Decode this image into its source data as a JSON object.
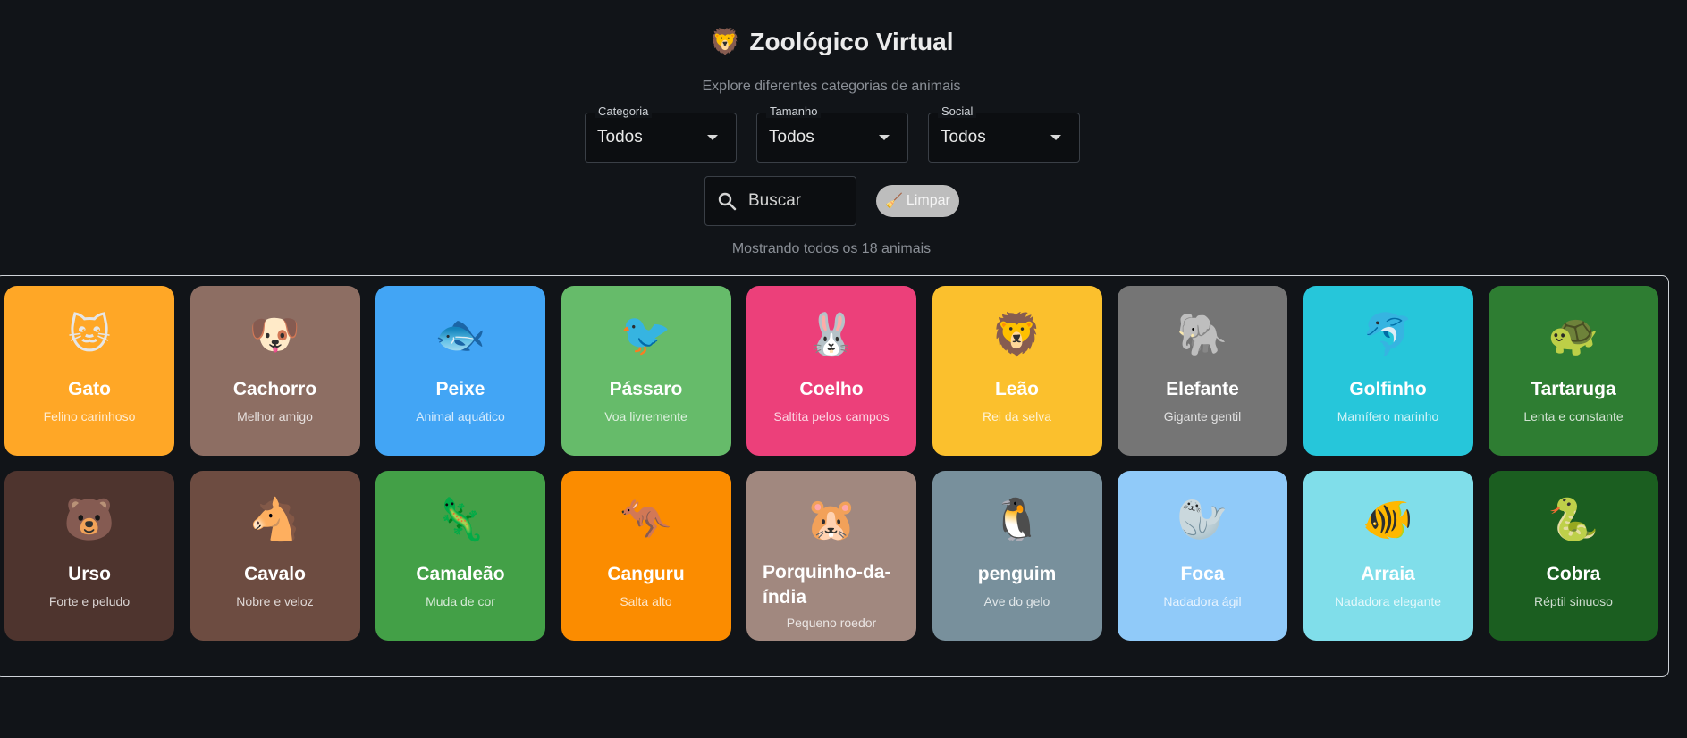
{
  "header": {
    "logo_emoji": "🦁",
    "title": "Zoológico Virtual",
    "subtitle": "Explore diferentes categorias de animais"
  },
  "filters": [
    {
      "label": "Categoria",
      "value": "Todos"
    },
    {
      "label": "Tamanho",
      "value": "Todos"
    },
    {
      "label": "Social",
      "value": "Todos"
    }
  ],
  "search": {
    "placeholder": "Buscar",
    "value": ""
  },
  "clear_button": {
    "emoji": "🧹",
    "label": "Limpar"
  },
  "status_text": "Mostrando todos os 18 animais",
  "animals": [
    {
      "emoji": "🐱",
      "name": "Gato",
      "desc": "Felino carinhoso",
      "color": "#FFA726"
    },
    {
      "emoji": "🐶",
      "name": "Cachorro",
      "desc": "Melhor amigo",
      "color": "#8D6E63"
    },
    {
      "emoji": "🐟",
      "name": "Peixe",
      "desc": "Animal aquático",
      "color": "#42A5F5"
    },
    {
      "emoji": "🐦",
      "name": "Pássaro",
      "desc": "Voa livremente",
      "color": "#66BB6A"
    },
    {
      "emoji": "🐰",
      "name": "Coelho",
      "desc": "Saltita pelos campos",
      "color": "#EC407A"
    },
    {
      "emoji": "🦁",
      "name": "Leão",
      "desc": "Rei da selva",
      "color": "#FBC02D"
    },
    {
      "emoji": "🐘",
      "name": "Elefante",
      "desc": "Gigante gentil",
      "color": "#757575"
    },
    {
      "emoji": "🐬",
      "name": "Golfinho",
      "desc": "Mamífero marinho",
      "color": "#26C6DA"
    },
    {
      "emoji": "🐢",
      "name": "Tartaruga",
      "desc": "Lenta e constante",
      "color": "#2E7D32"
    },
    {
      "emoji": "🐻",
      "name": "Urso",
      "desc": "Forte e peludo",
      "color": "#4E342E"
    },
    {
      "emoji": "🐴",
      "name": "Cavalo",
      "desc": "Nobre e veloz",
      "color": "#6D4C41"
    },
    {
      "emoji": "🦎",
      "name": "Camaleão",
      "desc": "Muda de cor",
      "color": "#43A047"
    },
    {
      "emoji": "🦘",
      "name": "Canguru",
      "desc": "Salta alto",
      "color": "#FB8C00"
    },
    {
      "emoji": "🐹",
      "name": "Porquinho-da-índia",
      "desc": "Pequeno roedor",
      "color": "#A1887F"
    },
    {
      "emoji": "🐧",
      "name": "penguim",
      "desc": "Ave do gelo",
      "color": "#78909C"
    },
    {
      "emoji": "🦭",
      "name": "Foca",
      "desc": "Nadadora ágil",
      "color": "#90CAF9"
    },
    {
      "emoji": "🐠",
      "name": "Arraia",
      "desc": "Nadadora elegante",
      "color": "#80DEEA"
    },
    {
      "emoji": "🐍",
      "name": "Cobra",
      "desc": "Réptil sinuoso",
      "color": "#1B5E20"
    }
  ]
}
